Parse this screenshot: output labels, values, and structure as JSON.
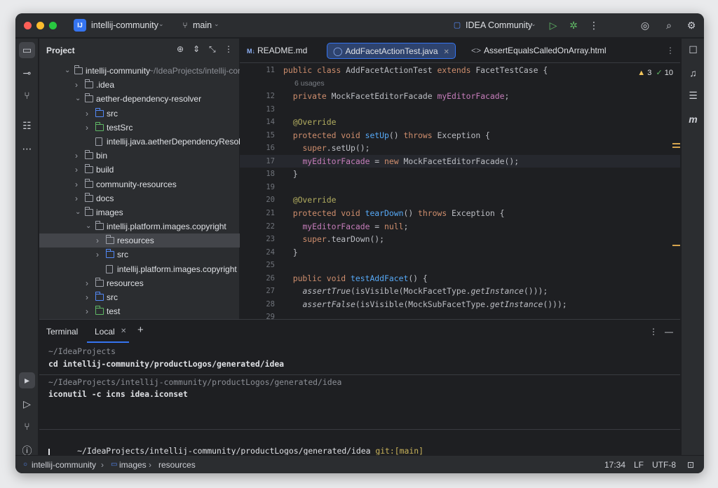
{
  "titlebar": {
    "project_badge": "IJ",
    "project_name": "intellij-community",
    "branch": "main",
    "run_config": "IDEA Community"
  },
  "project_panel": {
    "title": "Project",
    "tree": [
      {
        "label": "intellij-community",
        "suffix": "~/IdeaProjects/intellij-com",
        "expanded": true,
        "icon": "module-folder"
      },
      {
        "label": ".idea",
        "expanded": false,
        "icon": "folder"
      },
      {
        "label": "aether-dependency-resolver",
        "expanded": true,
        "icon": "module-folder"
      },
      {
        "label": "src",
        "expanded": false,
        "icon": "source-folder"
      },
      {
        "label": "testSrc",
        "expanded": false,
        "icon": "test-folder"
      },
      {
        "label": "intellij.java.aetherDependencyResolver",
        "icon": "iml-file"
      },
      {
        "label": "bin",
        "expanded": false,
        "icon": "folder"
      },
      {
        "label": "build",
        "expanded": false,
        "icon": "module-folder"
      },
      {
        "label": "community-resources",
        "expanded": false,
        "icon": "module-folder"
      },
      {
        "label": "docs",
        "expanded": false,
        "icon": "folder"
      },
      {
        "label": "images",
        "expanded": true,
        "icon": "module-folder"
      },
      {
        "label": "intellij.platform.images.copyright",
        "expanded": true,
        "icon": "module-folder"
      },
      {
        "label": "resources",
        "expanded": false,
        "icon": "folder",
        "selected": true
      },
      {
        "label": "src",
        "expanded": false,
        "icon": "source-folder"
      },
      {
        "label": "intellij.platform.images.copyright",
        "icon": "iml-file"
      },
      {
        "label": "resources",
        "expanded": false,
        "icon": "folder"
      },
      {
        "label": "src",
        "expanded": false,
        "icon": "source-folder"
      },
      {
        "label": "test",
        "expanded": false,
        "icon": "test-folder"
      }
    ]
  },
  "editor": {
    "tabs": [
      {
        "label": "README.md",
        "badge": "M↓",
        "active": false
      },
      {
        "label": "AddFacetActionTest.java",
        "active": true
      },
      {
        "label": "AssertEqualsCalledOnArray.html",
        "active": false
      }
    ],
    "inspections": {
      "warnings": "3",
      "ok": "10"
    },
    "usages_hint": "6 usages",
    "lines": [
      {
        "n": "11",
        "html": "<span class='kw'>public class</span> AddFacetActionTest <span class='kw'>extends</span> FacetTestCase {"
      },
      {
        "n": "",
        "usages": true
      },
      {
        "n": "12",
        "html": "  <span class='kw'>private</span> MockFacetEditorFacade <span class='fld'>myEditorFacade</span>;"
      },
      {
        "n": "13",
        "html": ""
      },
      {
        "n": "14",
        "html": "  <span class='ann'>@Override</span>"
      },
      {
        "n": "15",
        "html": "  <span class='kw'>protected void</span> <span class='fn'>setUp</span>() <span class='kw'>throws</span> Exception {"
      },
      {
        "n": "16",
        "html": "    <span class='kw'>super</span>.setUp();"
      },
      {
        "n": "17",
        "html": "    <span class='fld'>myEditorFacade</span> = <span class='kw'>new</span> MockFacetEditorFacade();",
        "current": true
      },
      {
        "n": "18",
        "html": "  }"
      },
      {
        "n": "19",
        "html": ""
      },
      {
        "n": "20",
        "html": "  <span class='ann'>@Override</span>"
      },
      {
        "n": "21",
        "html": "  <span class='kw'>protected void</span> <span class='fn'>tearDown</span>() <span class='kw'>throws</span> Exception {"
      },
      {
        "n": "22",
        "html": "    <span class='fld'>myEditorFacade</span> = <span class='kw'>null</span>;"
      },
      {
        "n": "23",
        "html": "    <span class='kw'>super</span>.tearDown();"
      },
      {
        "n": "24",
        "html": "  }"
      },
      {
        "n": "25",
        "html": ""
      },
      {
        "n": "26",
        "html": "  <span class='kw'>public void</span> <span class='fn'>testAddFacet</span>() {"
      },
      {
        "n": "27",
        "html": "    <span class='it'>assertTrue</span>(isVisible(MockFacetType.<span class='it'>getInstance</span>()));"
      },
      {
        "n": "28",
        "html": "    <span class='it'>assertFalse</span>(isVisible(MockSubFacetType.<span class='it'>getInstance</span>()));"
      },
      {
        "n": "29",
        "html": ""
      }
    ]
  },
  "terminal": {
    "title": "Terminal",
    "tab": "Local",
    "blocks": [
      {
        "path": "~/IdeaProjects",
        "command": "cd intellij-community/productLogos/generated/idea"
      },
      {
        "path": "~/IdeaProjects/intellij-community/productLogos/generated/idea",
        "command": "iconutil -c icns idea.iconset"
      }
    ],
    "prompt_path": "~/IdeaProjects/intellij-community/productLogos/generated/idea",
    "prompt_git": "git:[main]"
  },
  "statusbar": {
    "breadcrumb": [
      "intellij-community",
      "images",
      "resources"
    ],
    "position": "17:34",
    "line_ending": "LF",
    "encoding": "UTF-8"
  },
  "colors": {
    "accent": "#3574f0",
    "background": "#1e1f22",
    "panel": "#2b2d30",
    "warning": "#f2c55c",
    "ok": "#5fb865"
  }
}
